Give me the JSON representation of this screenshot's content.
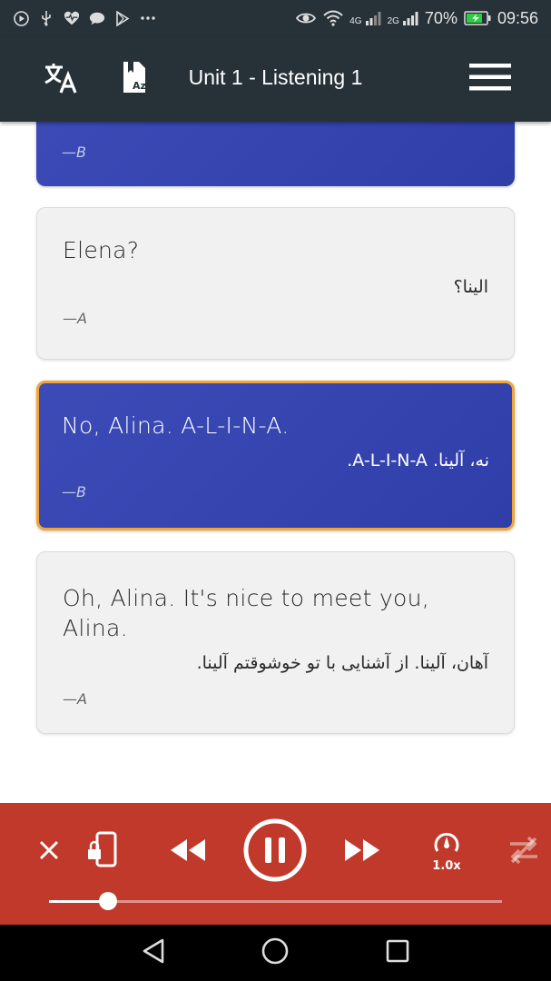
{
  "status_bar": {
    "time": "09:56",
    "battery": "70%",
    "net_4g": "4G",
    "net_2g": "2G"
  },
  "app_bar": {
    "title": "Unit 1 - Listening 1"
  },
  "dialogue": [
    {
      "speaker": "—B",
      "english": "",
      "persian": "",
      "style": "blue-partial"
    },
    {
      "speaker": "—A",
      "english": "Elena?",
      "persian": "الینا؟",
      "style": "gray"
    },
    {
      "speaker": "—B",
      "english": "No, Alina. A-L-I-N-A.",
      "persian": "نه، آلینا. A-L-I-N-A.",
      "style": "blue-active"
    },
    {
      "speaker": "—A",
      "english": "Oh, Alina. It's nice to meet you, Alina.",
      "persian": "آهان، آلینا. از آشنایی با تو خوشوقتم آلینا.",
      "style": "gray"
    }
  ],
  "player": {
    "speed_label": "1.0x",
    "progress": 0.13
  },
  "colors": {
    "app_bar": "#263238",
    "player": "#c0392b",
    "card_blue": "#3341ae",
    "card_gray": "#f1f1f1",
    "active_border": "#f0a43a"
  }
}
